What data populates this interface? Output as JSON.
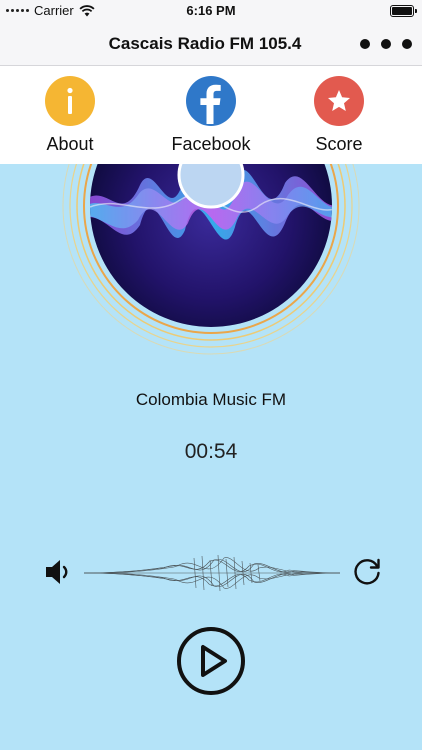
{
  "status_bar": {
    "carrier": "Carrier",
    "time": "6:16 PM",
    "wifi_icon": "wifi-icon",
    "battery_icon": "battery-icon"
  },
  "nav": {
    "title": "Cascais Radio FM 105.4",
    "more_icon": "more-horizontal-icon"
  },
  "actions": [
    {
      "label": "About",
      "icon": "info-icon",
      "color": "#f5b633"
    },
    {
      "label": "Facebook",
      "icon": "facebook-icon",
      "color": "#2f78c9"
    },
    {
      "label": "Score",
      "icon": "star-icon",
      "color": "#e25a4f"
    }
  ],
  "player": {
    "station_name": "Colombia Music FM",
    "elapsed": "00:54",
    "volume_icon": "speaker-icon",
    "refresh_icon": "refresh-icon",
    "play_icon": "play-icon"
  },
  "colors": {
    "background": "#b4e3f8",
    "bar": "#f6f6f8"
  }
}
